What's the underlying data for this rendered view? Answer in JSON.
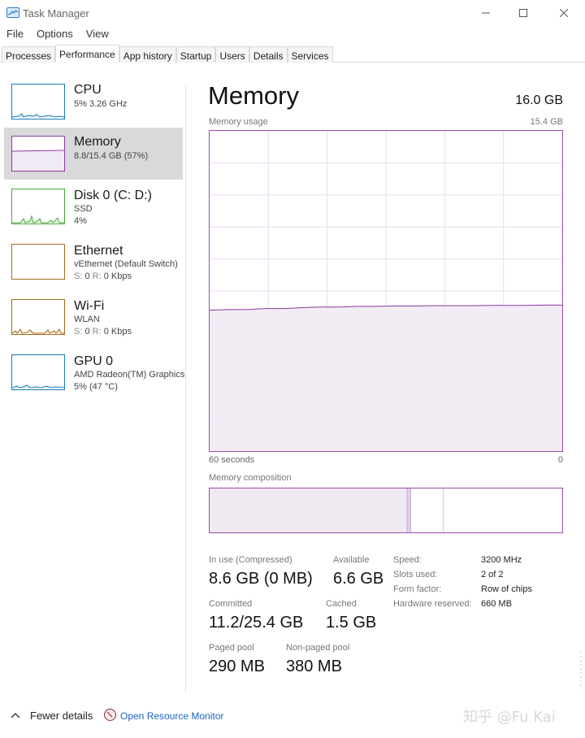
{
  "window": {
    "title": "Task Manager"
  },
  "menu": [
    "File",
    "Options",
    "View"
  ],
  "tabs": [
    "Processes",
    "Performance",
    "App history",
    "Startup",
    "Users",
    "Details",
    "Services"
  ],
  "sidebar": {
    "items": [
      {
        "name": "CPU",
        "line1": "5%  3.26 GHz",
        "line2": "",
        "color": "#1779ba"
      },
      {
        "name": "Memory",
        "line1": "8.8/15.4 GB (57%)",
        "line2": "",
        "color": "#8b3a9e"
      },
      {
        "name": "Disk 0 (C: D:)",
        "line1": "SSD",
        "line2": "4%",
        "color": "#4da63c"
      },
      {
        "name": "Ethernet",
        "line1": "vEthernet (Default Switch)",
        "line2_label_s": "S:",
        "line2_s": "0",
        "line2_label_r": "R:",
        "line2_r": "0 Kbps",
        "color": "#a7691e"
      },
      {
        "name": "Wi-Fi",
        "line1": "WLAN",
        "line2_label_s": "S:",
        "line2_s": "0",
        "line2_label_r": "R:",
        "line2_r": "0 Kbps",
        "color": "#a7691e"
      },
      {
        "name": "GPU 0",
        "line1": "AMD Radeon(TM) Graphics",
        "line2": "5%  (47 °C)",
        "color": "#1779ba"
      }
    ]
  },
  "main": {
    "title": "Memory",
    "total": "16.0 GB",
    "usage_label": "Memory usage",
    "usage_max": "15.4 GB",
    "graph_left_label": "60 seconds",
    "graph_right_label": "0",
    "composition_label": "Memory composition",
    "stats": {
      "in_use_label": "In use (Compressed)",
      "in_use_value": "8.6 GB (0 MB)",
      "available_label": "Available",
      "available_value": "6.6 GB",
      "committed_label": "Committed",
      "committed_value": "11.2/25.4 GB",
      "cached_label": "Cached",
      "cached_value": "1.5 GB",
      "paged_label": "Paged pool",
      "paged_value": "290 MB",
      "nonpaged_label": "Non-paged pool",
      "nonpaged_value": "380 MB"
    },
    "specs": [
      {
        "label": "Speed:",
        "value": "3200 MHz"
      },
      {
        "label": "Slots used:",
        "value": "2 of 2"
      },
      {
        "label": "Form factor:",
        "value": "Row of chips"
      },
      {
        "label": "Hardware reserved:",
        "value": "660 MB"
      }
    ]
  },
  "memory_usage_pct_history": [
    44,
    44.2,
    44.2,
    44.5,
    44.5,
    44.8,
    45,
    45,
    45.2,
    45.2,
    45.3,
    45.3,
    45.4,
    45.4,
    45.4,
    45.5,
    45.5,
    45.5,
    45.6,
    45.6
  ],
  "composition": {
    "in_use_fraction": 0.56,
    "modified_fraction": 0.01,
    "standby_fraction": 0.093
  },
  "colors": {
    "accent_memory": "#8b3a9e",
    "link": "#1b64c6",
    "selected_bg": "#d9d9d9"
  },
  "footer": {
    "fewer_details": "Fewer details",
    "resource_monitor": "Open Resource Monitor"
  },
  "watermark": "知乎 @Fu Kai"
}
